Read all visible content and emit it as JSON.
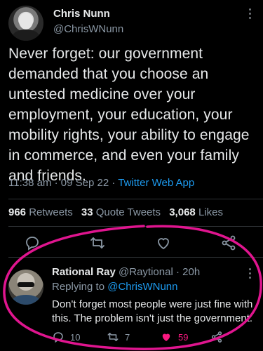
{
  "tweet": {
    "author_name": "Chris Nunn",
    "author_handle": "@ChrisWNunn",
    "text": "Never forget: our government demanded that you choose an untested medicine over your employment, your education, your mobility rights, your ability to engage in commerce, and even your family and friends.",
    "time": "11:38 am",
    "date": "09 Sep 22",
    "source": "Twitter Web App",
    "separator": "·",
    "retweets_count": "966",
    "retweets_label": "Retweets",
    "quotes_count": "33",
    "quotes_label": "Quote Tweets",
    "likes_count": "3,068",
    "likes_label": "Likes",
    "icons": [
      "reply-icon",
      "retweet-icon",
      "like-icon",
      "share-icon"
    ]
  },
  "reply": {
    "author_name": "Rational Ray",
    "author_handle": "@Raytional",
    "separator": "·",
    "age": "20h",
    "replying_prefix": "Replying to",
    "replying_to": "@ChrisWNunn",
    "text": "Don't forget most people were just fine with this. The problem isn't just the government.",
    "reply_count": "10",
    "retweet_count": "7",
    "like_count": "59"
  },
  "colors": {
    "background": "#000000",
    "link": "#1d9bf0",
    "muted": "#8b98a5",
    "like": "#f91880",
    "annotation": "#e0158f"
  }
}
